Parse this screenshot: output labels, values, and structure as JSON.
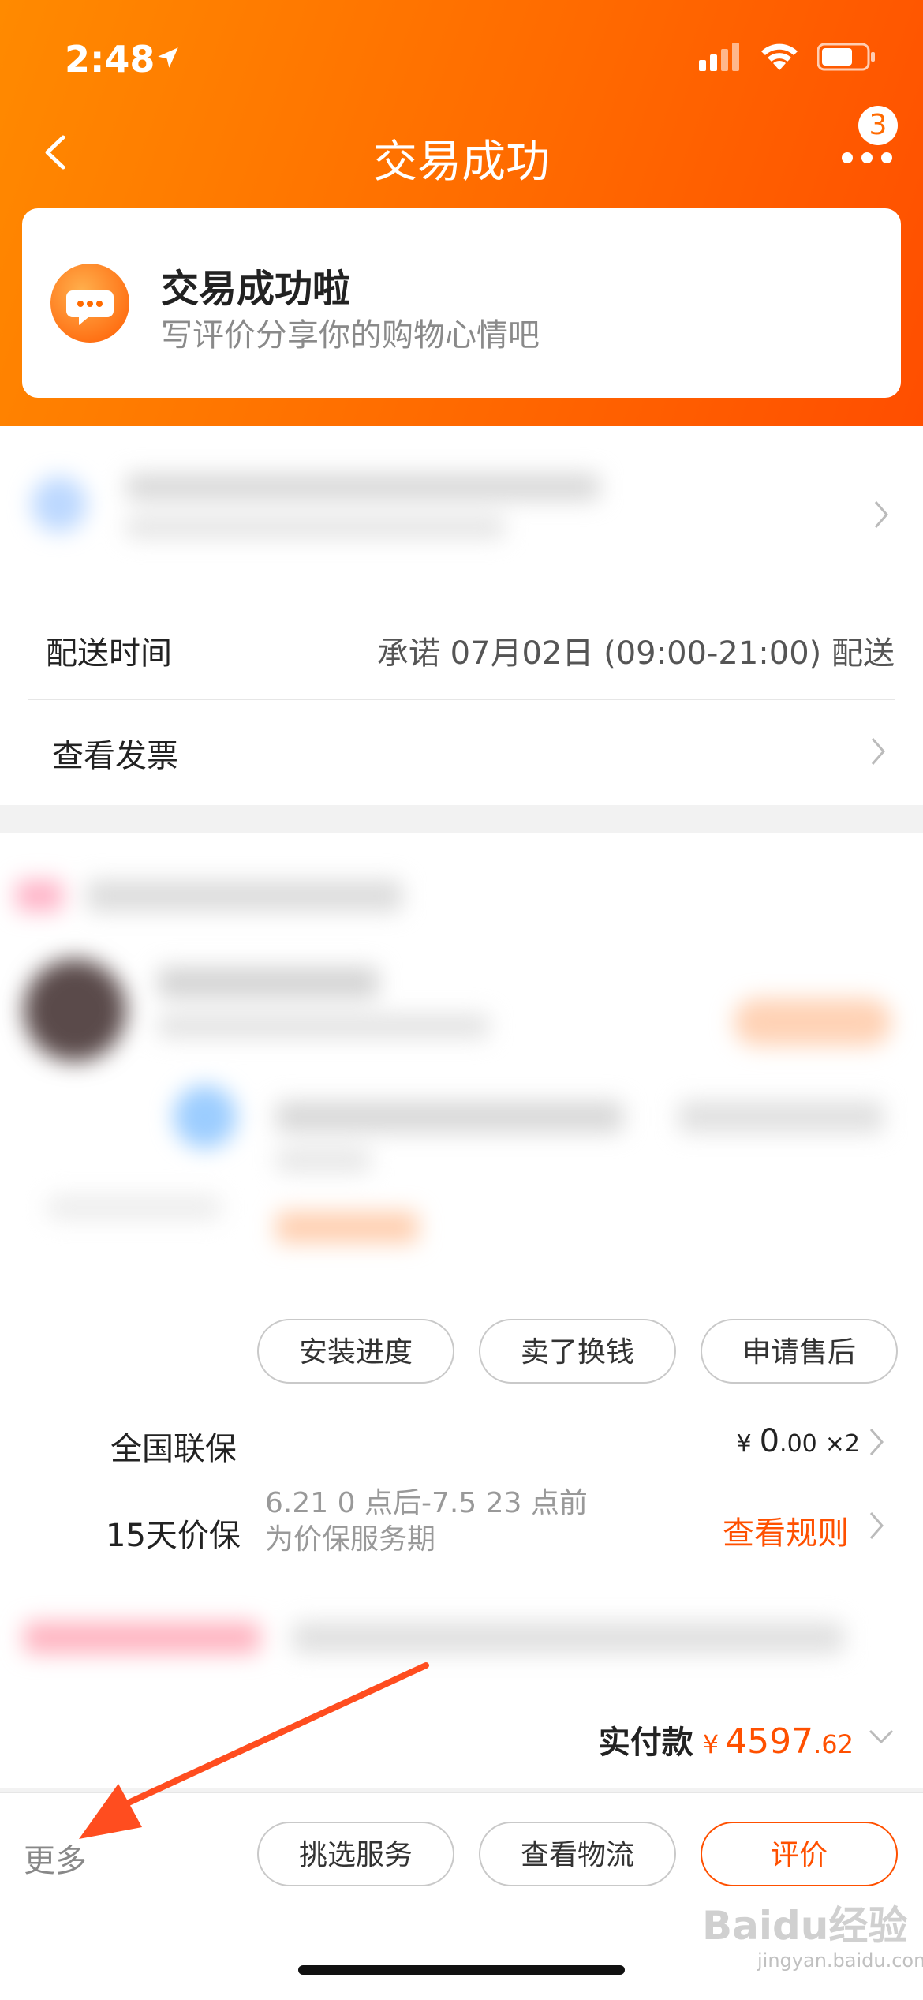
{
  "status_bar": {
    "time": "2:48"
  },
  "nav": {
    "title": "交易成功",
    "badge_count": "3"
  },
  "success_card": {
    "title": "交易成功啦",
    "subtitle": "写评价分享你的购物心情吧"
  },
  "delivery": {
    "label": "配送时间",
    "value": "承诺 07月02日 (09:00-21:00) 配送"
  },
  "invoice": {
    "label": "查看发票"
  },
  "order_actions": [
    {
      "label": "安装进度"
    },
    {
      "label": "卖了换钱"
    },
    {
      "label": "申请售后"
    }
  ],
  "services": [
    {
      "label": "全国联保",
      "price_symbol": "¥",
      "price_int": "0",
      "price_dec": ".00",
      "qty": "×2"
    },
    {
      "label": "15天价保",
      "desc_line1": "6.21 0 点后-7.5 23 点前",
      "desc_line2": "为价保服务期",
      "link": "查看规则"
    }
  ],
  "payment": {
    "label": "实付款",
    "symbol": "¥",
    "amount_int": "4597",
    "amount_dec": ".62"
  },
  "bottom_bar": {
    "more": "更多",
    "buttons": [
      {
        "label": "挑选服务"
      },
      {
        "label": "查看物流"
      },
      {
        "label": "评价"
      }
    ]
  },
  "watermark": {
    "text": "Baidu经验",
    "url": "jingyan.baidu.com"
  },
  "colors": {
    "accent": "#ff5000",
    "header_start": "#ff8a00",
    "header_end": "#ff4e00"
  }
}
